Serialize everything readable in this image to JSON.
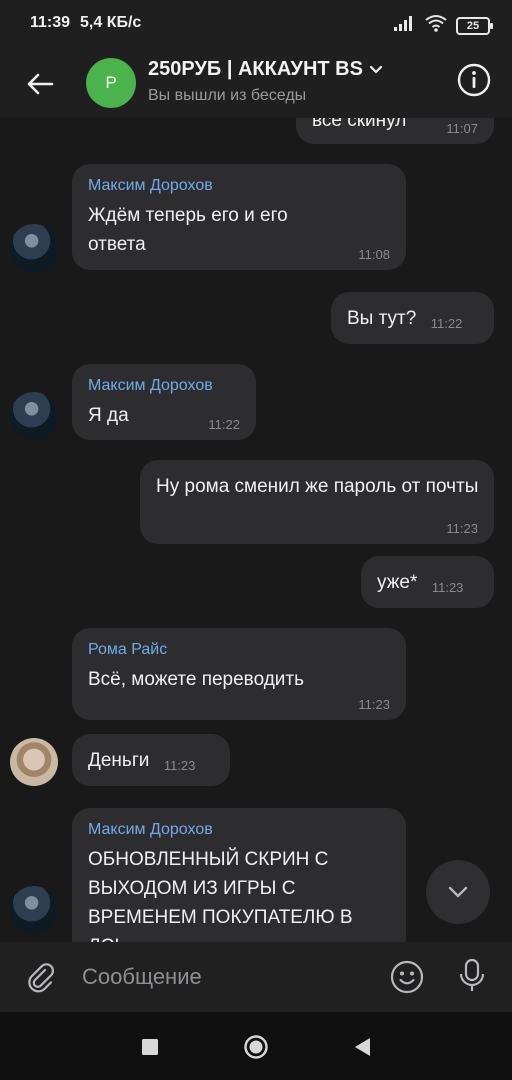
{
  "status_bar": {
    "time": "11:39",
    "speed": "5,4 КБ/с",
    "battery": "25"
  },
  "header": {
    "avatar_letter": "Р",
    "title": "250РУБ | АККАУНТ BS",
    "subtitle": "Вы вышли из беседы"
  },
  "messages": [
    {
      "side": "out",
      "text": "все скинул",
      "time": "11:07"
    },
    {
      "side": "in",
      "sender": "Максим Дорохов",
      "text": "Ждём теперь его и его ответа",
      "time": "11:08"
    },
    {
      "side": "out",
      "text": "Вы тут?",
      "time": "11:22"
    },
    {
      "side": "in",
      "sender": "Максим Дорохов",
      "text": "Я да",
      "time": "11:22"
    },
    {
      "side": "out",
      "text": "Ну рома сменил же пароль от почты",
      "time": "11:23"
    },
    {
      "side": "out",
      "text": "уже*",
      "time": "11:23"
    },
    {
      "side": "in",
      "sender": "Рома Райс",
      "text": "Всё, можете переводить",
      "time": "11:23"
    },
    {
      "side": "in",
      "text": "Деньги",
      "time": "11:23"
    },
    {
      "side": "in",
      "sender": "Максим Дорохов",
      "text": "ОБНОВЛЕННЫЙ СКРИН С ВЫХОДОМ ИЗ ИГРЫ С ВРЕМЕНЕМ ПОКУПАТЕЛЮ В ЛС!",
      "time": ""
    }
  ],
  "composer": {
    "placeholder": "Сообщение"
  },
  "icons": {
    "back": "arrow-left-icon",
    "info": "info-icon",
    "expand": "chevron-down-icon",
    "attach": "paperclip-icon",
    "emoji": "smile-icon",
    "mic": "microphone-icon",
    "scroll": "chevron-down-icon",
    "nav": [
      "square-icon",
      "circle-icon",
      "triangle-left-icon"
    ]
  },
  "colors": {
    "accent": "#71aaeb",
    "avatar_green": "#4bb34b",
    "bubble": "#2d2d2f"
  }
}
